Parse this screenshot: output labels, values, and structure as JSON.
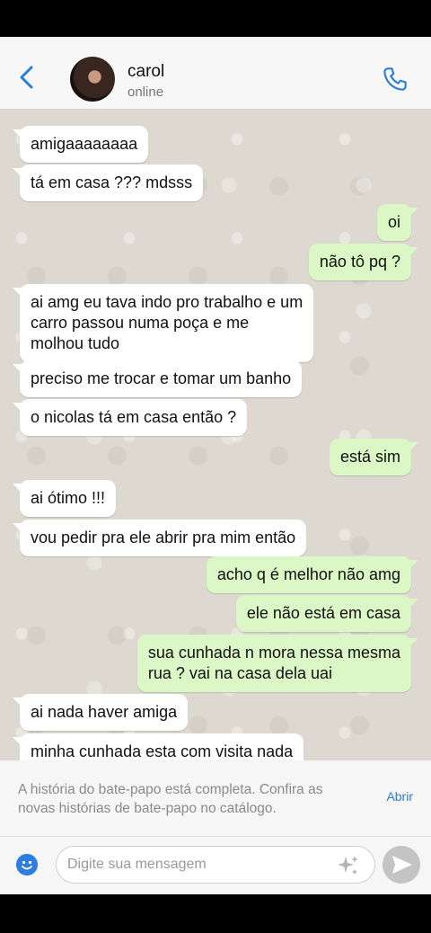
{
  "header": {
    "contact_name": "carol",
    "contact_status": "online"
  },
  "messages": [
    {
      "dir": "in",
      "text": "amigaaaaaaaa"
    },
    {
      "dir": "in",
      "text": "tá em casa ??? mdsss"
    },
    {
      "dir": "out",
      "text": "oi"
    },
    {
      "dir": "out",
      "text": "não tô pq ?"
    },
    {
      "dir": "in",
      "text": "ai amg eu tava indo pro trabalho e um\ncarro passou numa poça e me\nmolhou tudo"
    },
    {
      "dir": "in",
      "text": "preciso me trocar e tomar um banho"
    },
    {
      "dir": "in",
      "text": "o nicolas tá em casa então ?"
    },
    {
      "dir": "out",
      "text": "está sim"
    },
    {
      "dir": "in",
      "text": "ai ótimo !!!"
    },
    {
      "dir": "in",
      "text": "vou pedir pra ele abrir pra mim então"
    },
    {
      "dir": "out",
      "text": "acho q é melhor não amg"
    },
    {
      "dir": "out",
      "text": "ele não está em casa"
    },
    {
      "dir": "out",
      "text": "sua cunhada n mora nessa mesma\nrua ? vai na casa dela uai"
    },
    {
      "dir": "in",
      "text": "ai nada haver amiga"
    },
    {
      "dir": "in",
      "text": "minha cunhada esta com visita nada"
    }
  ],
  "notice": {
    "text": "A história do bate-papo está completa. Confira as novas histórias de bate-papo no catálogo.",
    "link_label": "Abrir"
  },
  "input": {
    "placeholder": "Digite sua mensagem"
  },
  "icons": {
    "back": "chevron-left-icon",
    "call": "phone-icon",
    "emoji": "emoji-icon",
    "ai": "sparkle-icon",
    "send": "send-icon"
  },
  "colors": {
    "accent": "#2a7cd6",
    "incoming_bubble": "#ffffff",
    "outgoing_bubble": "#dbf7c5"
  }
}
